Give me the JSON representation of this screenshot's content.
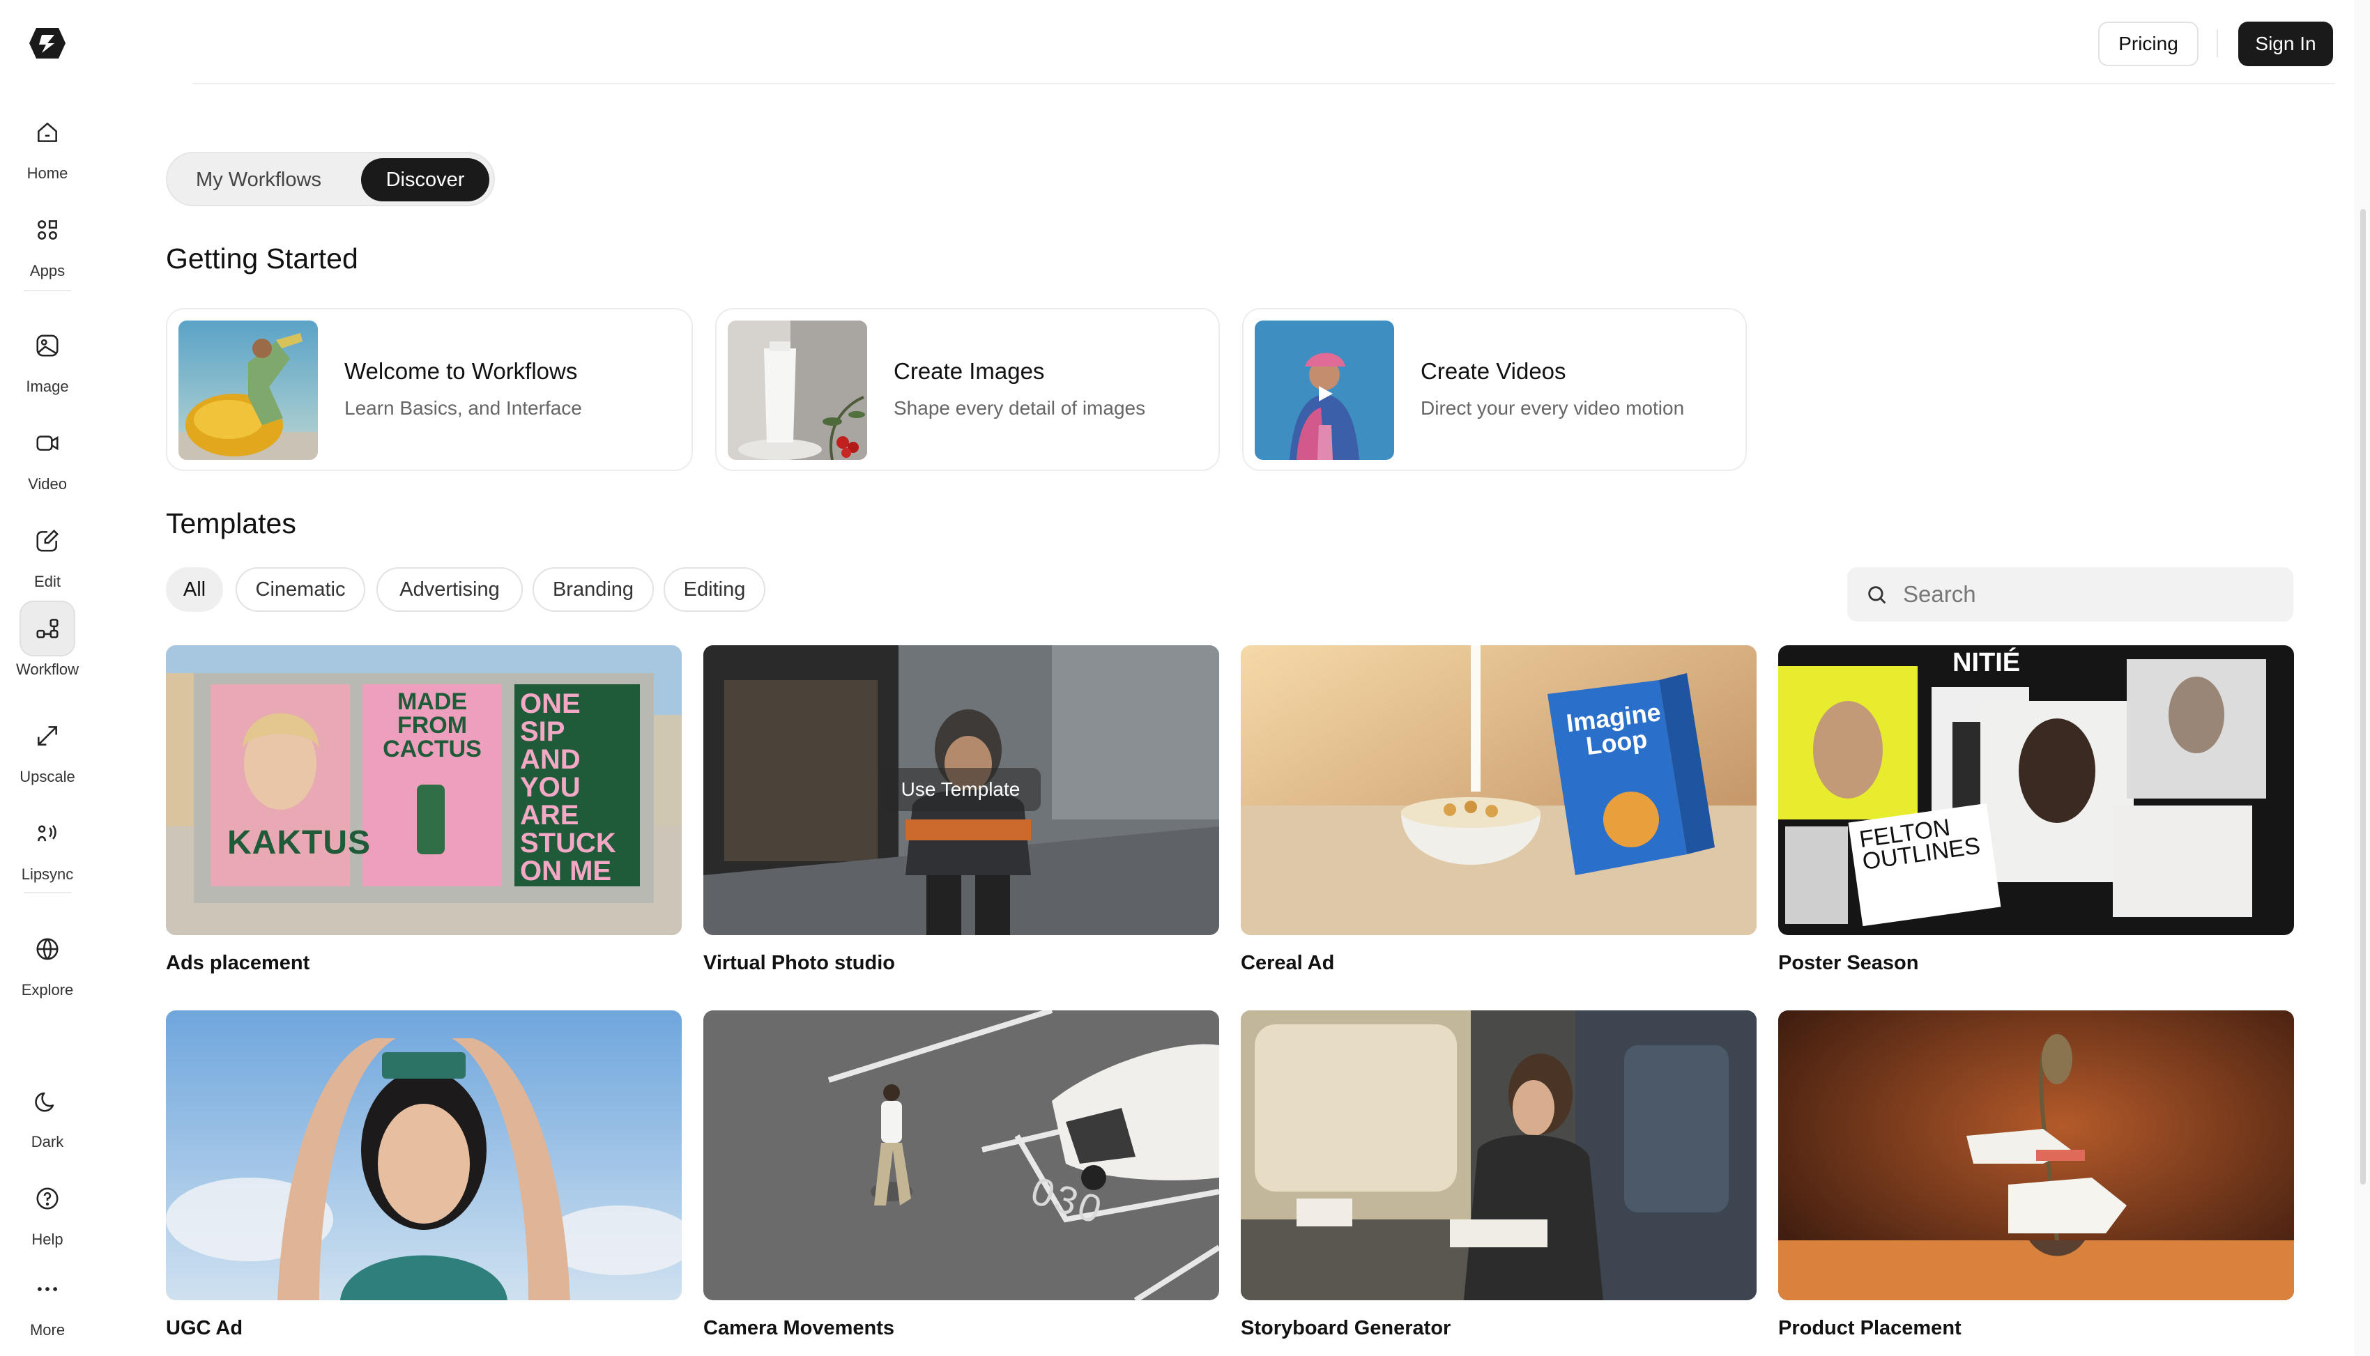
{
  "sidebar": {
    "items": [
      {
        "label": "Home"
      },
      {
        "label": "Apps"
      },
      {
        "label": "Image"
      },
      {
        "label": "Video"
      },
      {
        "label": "Edit"
      },
      {
        "label": "Workflow"
      },
      {
        "label": "Upscale"
      },
      {
        "label": "Lipsync"
      },
      {
        "label": "Explore"
      },
      {
        "label": "Dark"
      },
      {
        "label": "Help"
      },
      {
        "label": "More"
      }
    ],
    "active": "Workflow"
  },
  "header": {
    "pricing_label": "Pricing",
    "signin_label": "Sign In"
  },
  "tabs": {
    "my_workflows": "My Workflows",
    "discover": "Discover",
    "active": "Discover"
  },
  "getting_started": {
    "title": "Getting Started",
    "cards": [
      {
        "title": "Welcome to Workflows",
        "subtitle": "Learn Basics, and Interface"
      },
      {
        "title": "Create Images",
        "subtitle": "Shape every detail of images"
      },
      {
        "title": "Create Videos",
        "subtitle": "Direct your every video motion"
      }
    ]
  },
  "templates": {
    "title": "Templates",
    "filters": [
      "All",
      "Cinematic",
      "Advertising",
      "Branding",
      "Editing"
    ],
    "active_filter": "All",
    "search_placeholder": "Search",
    "hover_action": "Use Template",
    "items": [
      {
        "label": "Ads placement",
        "poster_1": "KAKTUS",
        "poster_2": "MADE FROM CACTUS",
        "poster_3": "ONE SIP AND YOU ARE STUCK ON ME"
      },
      {
        "label": "Virtual Photo studio"
      },
      {
        "label": "Cereal Ad",
        "box_text": "Imagine Loop"
      },
      {
        "label": "Poster Season",
        "text_a": "NITIÉ",
        "text_b": "FELTON OUTLINES"
      },
      {
        "label": "UGC Ad"
      },
      {
        "label": "Camera Movements",
        "road_text": "030"
      },
      {
        "label": "Storyboard Generator"
      },
      {
        "label": "Product Placement"
      }
    ]
  },
  "colors": {
    "primary_dark": "#1a1a1a",
    "chip_active_bg": "#efefef",
    "border": "#e2e2e2"
  }
}
